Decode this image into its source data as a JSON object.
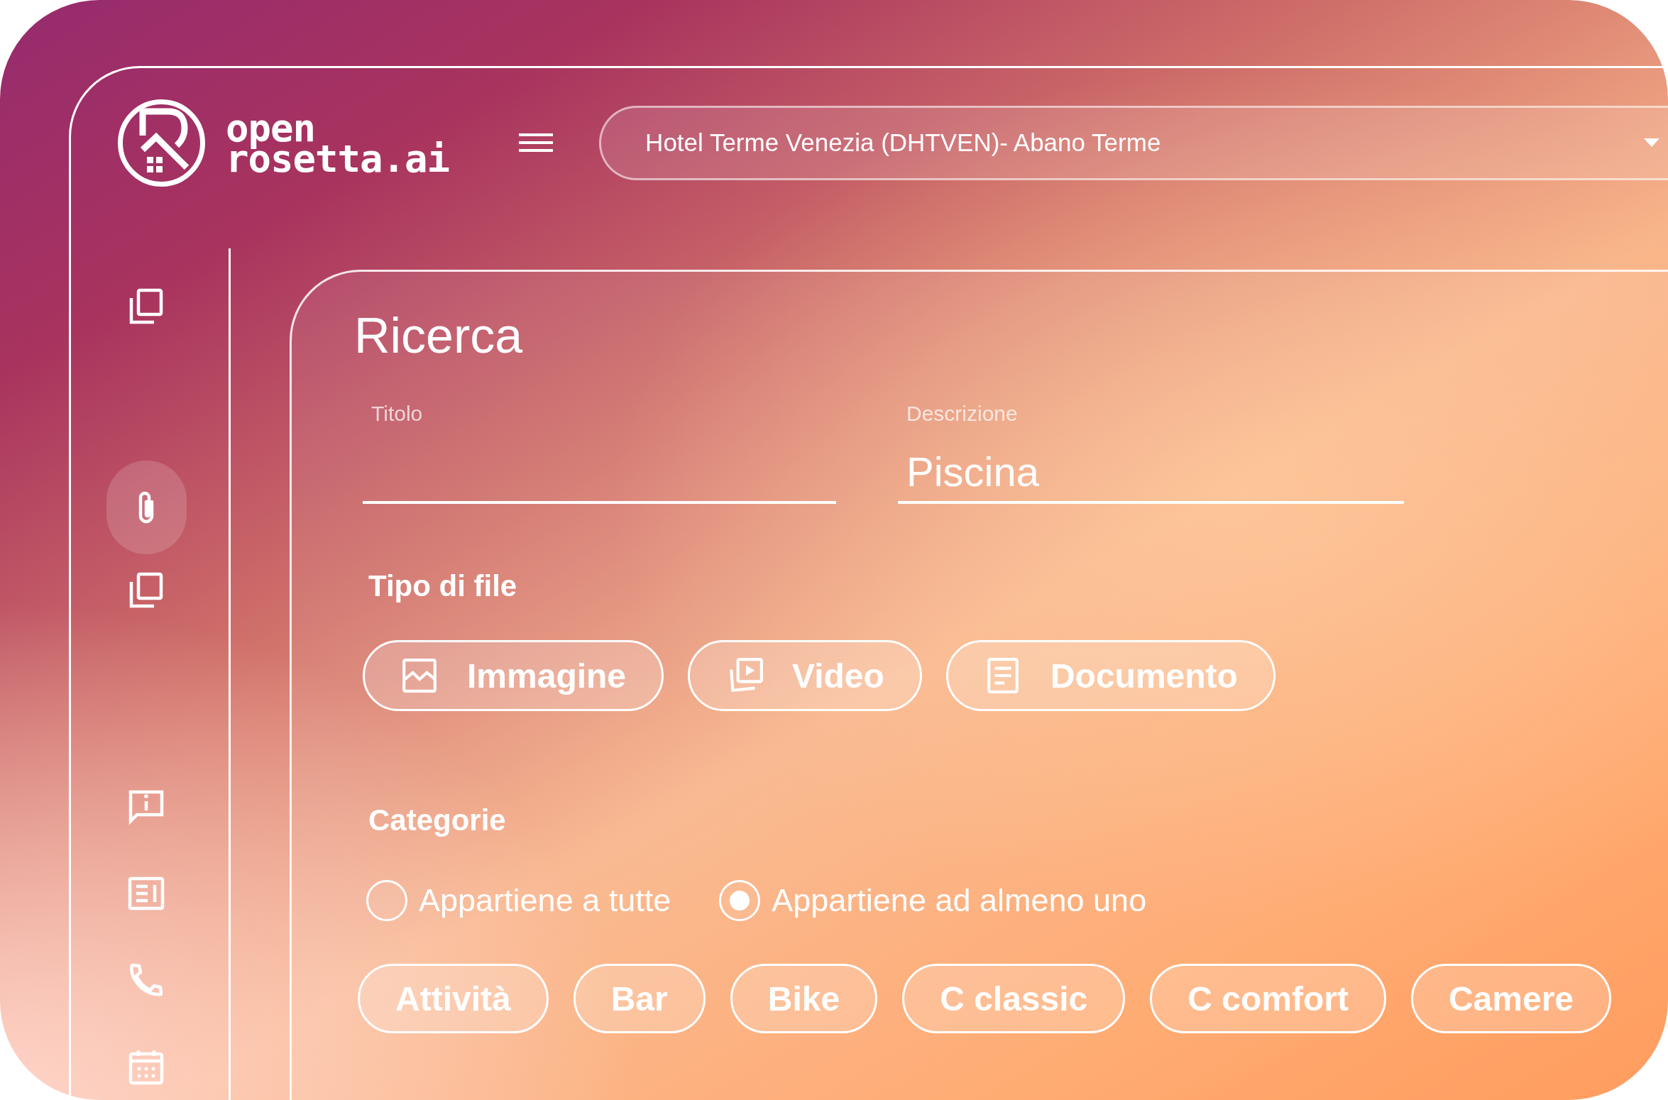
{
  "logo": {
    "line1": "open",
    "line2": "rosetta.ai"
  },
  "hotel_select": {
    "value": "Hotel Terme Venezia (DHTVEN)- Abano Terme"
  },
  "sidebar": {
    "groups": [
      {
        "items": [
          {
            "kind": "copy",
            "selected": false
          }
        ]
      },
      {
        "items": [
          {
            "kind": "attach",
            "selected": true
          },
          {
            "kind": "copy",
            "selected": false
          }
        ]
      },
      {
        "items": [
          {
            "kind": "info",
            "selected": false
          },
          {
            "kind": "article",
            "selected": false
          },
          {
            "kind": "phone",
            "selected": false
          },
          {
            "kind": "calendar",
            "selected": false
          }
        ]
      }
    ]
  },
  "search": {
    "title": "Ricerca",
    "fields": [
      {
        "label": "Titolo"
      },
      {
        "label": "Descrizione",
        "value": "Piscina"
      }
    ],
    "file_type": {
      "label": "Tipo di file",
      "options": [
        {
          "kind": "image",
          "label": "Immagine"
        },
        {
          "kind": "video",
          "label": "Video"
        },
        {
          "kind": "document",
          "label": "Documento"
        }
      ]
    },
    "categories": {
      "label": "Categorie",
      "match_options": [
        {
          "label": "Appartiene a tutte",
          "selected": false
        },
        {
          "label": "Appartiene ad almeno uno",
          "selected": true
        }
      ],
      "tags": [
        "Attività",
        "Bar",
        "Bike",
        "C classic",
        "C comfort",
        "Camere"
      ]
    }
  }
}
